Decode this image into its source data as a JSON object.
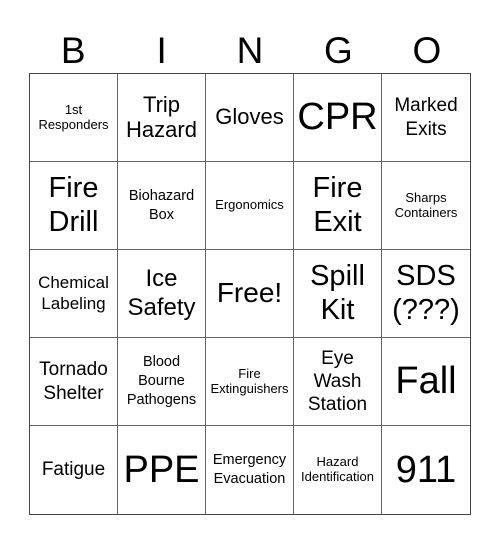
{
  "header": [
    "B",
    "I",
    "N",
    "G",
    "O"
  ],
  "cells": [
    {
      "text": "1st\nResponders",
      "size": "s13"
    },
    {
      "text": "Trip\nHazard",
      "size": "s22"
    },
    {
      "text": "Gloves",
      "size": "s22"
    },
    {
      "text": "CPR",
      "size": "s38"
    },
    {
      "text": "Marked\nExits",
      "size": "s19"
    },
    {
      "text": "Fire\nDrill",
      "size": "s30"
    },
    {
      "text": "Biohazard\nBox",
      "size": "s14"
    },
    {
      "text": "Ergonomics",
      "size": "s13"
    },
    {
      "text": "Fire\nExit",
      "size": "s30"
    },
    {
      "text": "Sharps\nContainers",
      "size": "s13"
    },
    {
      "text": "Chemical\nLabeling",
      "size": "s17"
    },
    {
      "text": "Ice\nSafety",
      "size": "s24"
    },
    {
      "text": "Free!",
      "size": "s27"
    },
    {
      "text": "Spill\nKit",
      "size": "s30"
    },
    {
      "text": "SDS\n(???)",
      "size": "s30"
    },
    {
      "text": "Tornado\nShelter",
      "size": "s19"
    },
    {
      "text": "Blood\nBourne\nPathogens",
      "size": "s14"
    },
    {
      "text": "Fire\nExtinguishers",
      "size": "s13"
    },
    {
      "text": "Eye\nWash\nStation",
      "size": "s19"
    },
    {
      "text": "Fall",
      "size": "s38"
    },
    {
      "text": "Fatigue",
      "size": "s19"
    },
    {
      "text": "PPE",
      "size": "s38"
    },
    {
      "text": "Emergency\nEvacuation",
      "size": "s14"
    },
    {
      "text": "Hazard\nIdentification",
      "size": "s13"
    },
    {
      "text": "911",
      "size": "s38"
    }
  ]
}
